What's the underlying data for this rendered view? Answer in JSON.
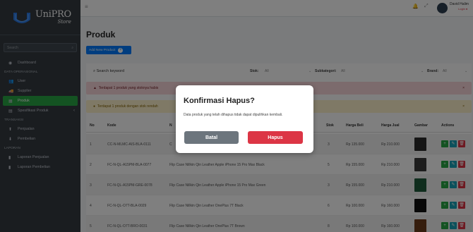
{
  "brand": {
    "name": "UniPRO",
    "tagline": "Store"
  },
  "sidebar": {
    "search_placeholder": "Search",
    "items": [
      {
        "type": "item",
        "label": "Dashboard",
        "icon": "dashboard-icon",
        "glyph": "◉"
      },
      {
        "type": "header",
        "label": "DATA OPERASIONAL"
      },
      {
        "type": "item",
        "label": "User",
        "icon": "users-icon",
        "glyph": "👥"
      },
      {
        "type": "item",
        "label": "Supplier",
        "icon": "truck-icon",
        "glyph": "🚚"
      },
      {
        "type": "item",
        "label": "Produk",
        "icon": "boxes-icon",
        "glyph": "▦",
        "active": true
      },
      {
        "type": "item",
        "label": "Spesifikasi Produk",
        "icon": "list-icon",
        "glyph": "▤",
        "caret": "‹"
      },
      {
        "type": "header",
        "label": "TRANSAKSI"
      },
      {
        "type": "item",
        "label": "Penjualan",
        "icon": "cart-icon",
        "glyph": "⬆"
      },
      {
        "type": "item",
        "label": "Pembelian",
        "icon": "purchase-icon",
        "glyph": "⬇"
      },
      {
        "type": "header",
        "label": "LAPORAN"
      },
      {
        "type": "item",
        "label": "Laporan Penjualan",
        "icon": "file-icon",
        "glyph": "▮"
      },
      {
        "type": "item",
        "label": "Laporan Pembelian",
        "icon": "file-icon",
        "glyph": "▮"
      }
    ]
  },
  "topbar": {
    "user_name": "David Halim",
    "user_status": "Login ●"
  },
  "page": {
    "title": "Produk",
    "add_button": "Add New Product"
  },
  "filters": {
    "search_placeholder": "Search keyword",
    "stok_label": "Stok:",
    "stok_value": "All",
    "subkategori_label": "Subkategori:",
    "subkategori_value": "All",
    "brand_label": "Brand:",
    "brand_value": "All"
  },
  "alerts": {
    "red": "Terdapat 1 produk yang stoknya habis",
    "yellow": "Terdapat 1 produk dengan stok rendah"
  },
  "table": {
    "headers": [
      "No",
      "Kode",
      "N",
      "Stok",
      "Harga Beli",
      "Harga Jual",
      "Gambar",
      "Actions"
    ],
    "rows": [
      {
        "no": "1",
        "kode": "CC-N-MLMC-AIS-BLA-0111",
        "nama": "C",
        "stok": "3",
        "beli": "Rp 135.000",
        "jual": "Rp 210.000",
        "thumb": "#2a2a2a"
      },
      {
        "no": "2",
        "kode": "FC-N-QL-A15PM-BLA-0077",
        "nama": "Flip Case Nillkin Qin Leather Apple iPhone 15 Pro Max Black",
        "stok": "5",
        "beli": "Rp 155.000",
        "jual": "Rp 210.000",
        "thumb": "#3a3a3a"
      },
      {
        "no": "3",
        "kode": "FC-N-QL-A15PM-GRE-0078",
        "nama": "Flip Case Nillkin Qin Leather Apple iPhone 15 Pro Max Green",
        "stok": "3",
        "beli": "Rp 155.000",
        "jual": "Rp 210.000",
        "thumb": "#1f5a3a"
      },
      {
        "no": "4",
        "kode": "FC-N-QL-O7T-BLA-0029",
        "nama": "Flip Case Nillkin Qin Leather OnePlus 7T Black",
        "stok": "6",
        "beli": "Rp 100.000",
        "jual": "Rp 160.000",
        "thumb": "#111111"
      },
      {
        "no": "5",
        "kode": "FC-N-QL-O7T-BRO-0031",
        "nama": "Flip Case Nillkin Qin Leather OnePlus 7T Brown",
        "stok": "8",
        "beli": "Rp 100.000",
        "jual": "Rp 160.000",
        "thumb": "#6b3a1a"
      }
    ]
  },
  "modal": {
    "title": "Konfirmasi Hapus?",
    "body": "Data produk yang telah dihapus tidak dapat dipulihkan kembali.",
    "cancel": "Batal",
    "confirm": "Hapus"
  },
  "colors": {
    "primary": "#007bff",
    "success": "#28a745",
    "danger": "#dc3545",
    "info": "#17a2b8",
    "sidebar": "#343a40"
  }
}
